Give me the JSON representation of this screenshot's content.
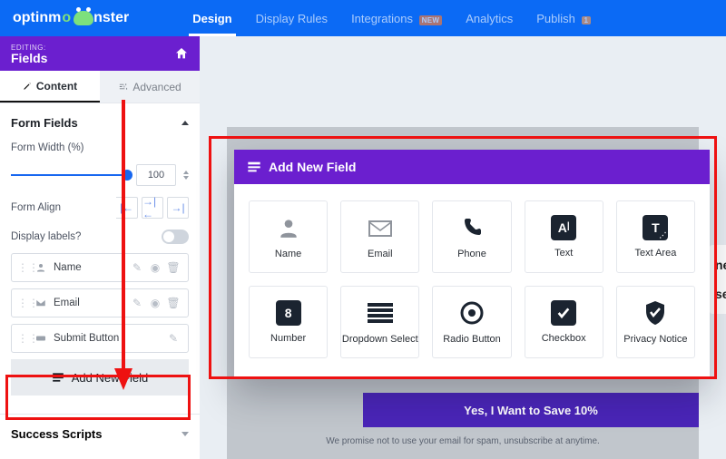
{
  "brand": "optinmonster",
  "nav": {
    "items": [
      "Design",
      "Display Rules",
      "Integrations",
      "Analytics",
      "Publish"
    ],
    "active": "Design",
    "integrations_badge": "NEW",
    "publish_badge": "1"
  },
  "editing": {
    "label": "EDITING:",
    "title": "Fields"
  },
  "sidebar_tabs": {
    "content": "Content",
    "advanced": "Advanced",
    "active": "content"
  },
  "panel": {
    "heading": "Form Fields",
    "width_label": "Form Width (%)",
    "width_value": "100",
    "align_label": "Form Align",
    "display_labels": "Display labels?",
    "display_labels_on": false,
    "fields": [
      {
        "label": "Name",
        "actions": [
          "edit",
          "view",
          "delete"
        ]
      },
      {
        "label": "Email",
        "actions": [
          "edit",
          "view",
          "delete"
        ]
      },
      {
        "label": "Submit Button",
        "actions": [
          "edit"
        ]
      }
    ],
    "add_new": "Add New Field"
  },
  "success_section": "Success Scripts",
  "preview": {
    "cta": "Yes, I Want to Save 10%",
    "side_hint_1": "ne",
    "side_hint_2": "se o",
    "promise": "We promise not to use your email for spam, unsubscribe at anytime."
  },
  "picker": {
    "title": "Add New Field",
    "tiles": [
      {
        "name": "Name",
        "icon": "person"
      },
      {
        "name": "Email",
        "icon": "envelope"
      },
      {
        "name": "Phone",
        "icon": "phone"
      },
      {
        "name": "Text",
        "icon": "text"
      },
      {
        "name": "Text Area",
        "icon": "textarea"
      },
      {
        "name": "Number",
        "icon": "number"
      },
      {
        "name": "Dropdown Select",
        "icon": "dropdown"
      },
      {
        "name": "Radio Button",
        "icon": "radio"
      },
      {
        "name": "Checkbox",
        "icon": "checkbox"
      },
      {
        "name": "Privacy Notice",
        "icon": "shield"
      }
    ]
  }
}
